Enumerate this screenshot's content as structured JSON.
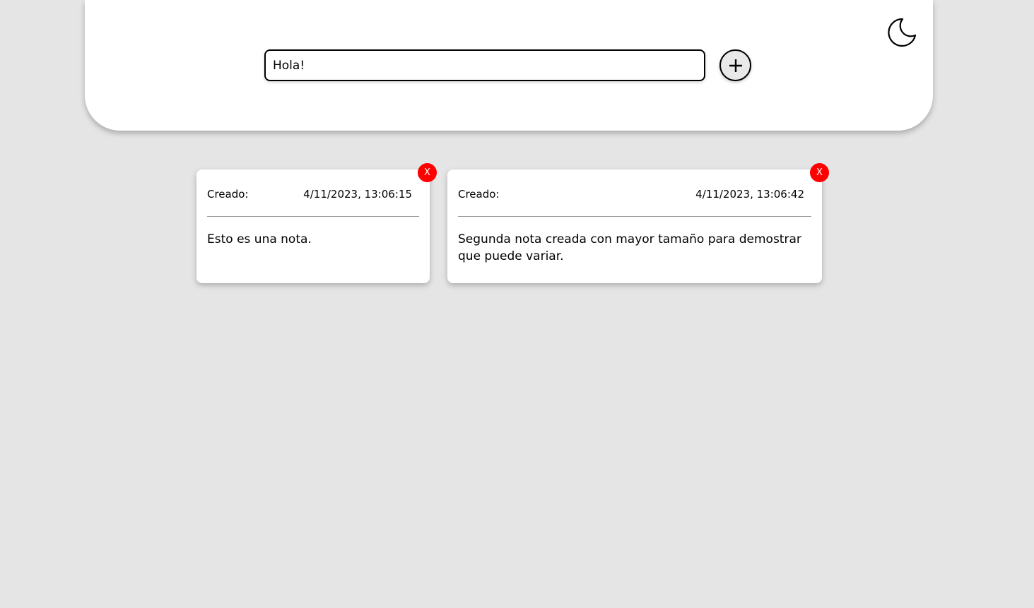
{
  "header": {
    "theme_icon": "moon-icon",
    "input": {
      "value": "Hola!",
      "placeholder": ""
    },
    "add_icon": "plus-icon"
  },
  "notes": [
    {
      "created_label": "Creado:",
      "timestamp": "4/11/2023, 13:06:15",
      "text": "Esto es una nota.",
      "delete_label": "X"
    },
    {
      "created_label": "Creado:",
      "timestamp": "4/11/2023, 13:06:42",
      "text": "Segunda nota creada con mayor tamaño para demostrar que puede variar.",
      "delete_label": "X"
    }
  ],
  "colors": {
    "background": "#e5e5e5",
    "delete": "#ff0000"
  }
}
